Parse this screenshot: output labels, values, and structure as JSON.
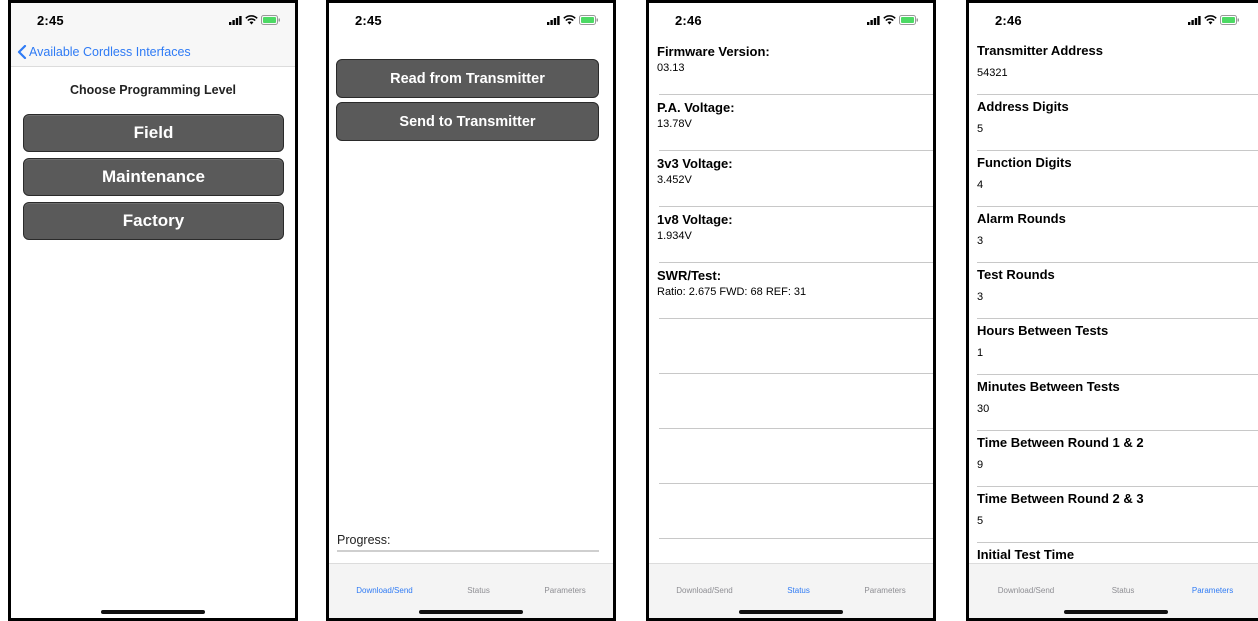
{
  "screen1": {
    "time": "2:45",
    "back_label": "Available Cordless Interfaces",
    "subtitle": "Choose Programming Level",
    "levels": [
      "Field",
      "Maintenance",
      "Factory"
    ]
  },
  "screen2": {
    "time": "2:45",
    "read_label": "Read from Transmitter",
    "send_label": "Send to Transmitter",
    "progress_label": "Progress:",
    "progress_value": 0
  },
  "screen3": {
    "time": "2:46",
    "rows": [
      {
        "title": "Firmware Version:",
        "value": "03.13"
      },
      {
        "title": "P.A. Voltage:",
        "value": "13.78V"
      },
      {
        "title": "3v3 Voltage:",
        "value": "3.452V"
      },
      {
        "title": "1v8 Voltage:",
        "value": "1.934V"
      },
      {
        "title": "SWR/Test:",
        "value": "Ratio: 2.675 FWD: 68 REF: 31"
      }
    ]
  },
  "screen4": {
    "time": "2:46",
    "rows": [
      {
        "title": "Transmitter Address",
        "value": "54321"
      },
      {
        "title": "Address Digits",
        "value": "5"
      },
      {
        "title": "Function Digits",
        "value": "4"
      },
      {
        "title": "Alarm Rounds",
        "value": "3"
      },
      {
        "title": "Test Rounds",
        "value": "3"
      },
      {
        "title": "Hours Between Tests",
        "value": "1"
      },
      {
        "title": "Minutes Between Tests",
        "value": "30"
      },
      {
        "title": "Time Between Round 1 & 2",
        "value": "9"
      },
      {
        "title": "Time Between Round 2 & 3",
        "value": "5"
      },
      {
        "title": "Initial Test Time",
        "value": ""
      }
    ]
  },
  "tabs": {
    "download": "Download/Send",
    "status": "Status",
    "parameters": "Parameters"
  },
  "colors": {
    "accent": "#2f7bf5",
    "button": "#5a5a5a",
    "battery": "#4cd964"
  }
}
